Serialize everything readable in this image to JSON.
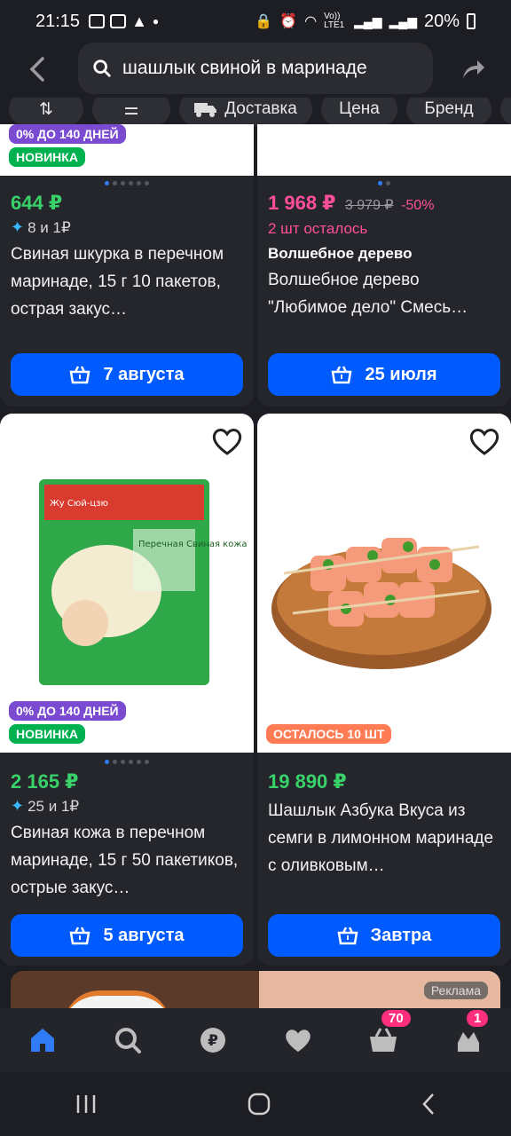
{
  "status": {
    "time": "21:15",
    "battery": "20%",
    "net_label": "Vo)) LTE1"
  },
  "search": {
    "query": "шашлык свиной в маринаде"
  },
  "chips": [
    "⇅",
    "⚌",
    "Доставка",
    "Цена",
    "Бренд",
    "I"
  ],
  "cards": [
    {
      "badges": [
        {
          "text": "0% ДО 140 ДНЕЙ",
          "color": "purple"
        },
        {
          "text": "НОВИНКА",
          "color": "green"
        }
      ],
      "price": "644 ₽",
      "bonus": "8 и 1₽",
      "title": "Свиная шкурка в перечном маринаде, 15 г 10 пакетов, острая закус…",
      "button": "7 августа"
    },
    {
      "price": "1 968 ₽",
      "old_price": "3 979 ₽",
      "discount": "-50%",
      "stock": "2 шт осталось",
      "brand": "Волшебное дерево",
      "title": "Волшебное дерево \"Любимое дело\" Смесь…",
      "button": "25 июля"
    },
    {
      "badges": [
        {
          "text": "0% ДО 140 ДНЕЙ",
          "color": "purple"
        },
        {
          "text": "НОВИНКА",
          "color": "green"
        }
      ],
      "price": "2 165 ₽",
      "bonus": "25 и 1₽",
      "title": "Свиная кожа в перечном маринаде, 15 г 50 пакетиков, острые закус…",
      "button": "5 августа"
    },
    {
      "badges": [
        {
          "text": "ОСТАЛОСЬ 10 ШТ",
          "color": "orange"
        }
      ],
      "price": "19 890 ₽",
      "title": "Шашлык Азбука Вкуса из семги в лимонном маринаде с оливковым…",
      "button": "Завтра"
    }
  ],
  "package_text": {
    "top": "Жу Сюй-цзю",
    "right": "Перечная Свиная кожа"
  },
  "ad": {
    "label": "Реклама"
  },
  "nav": {
    "cart_count": "70",
    "profile_count": "1"
  },
  "colors": {
    "accent": "#005bff",
    "price_green": "#39d26a",
    "price_pink": "#ff4f9a"
  }
}
